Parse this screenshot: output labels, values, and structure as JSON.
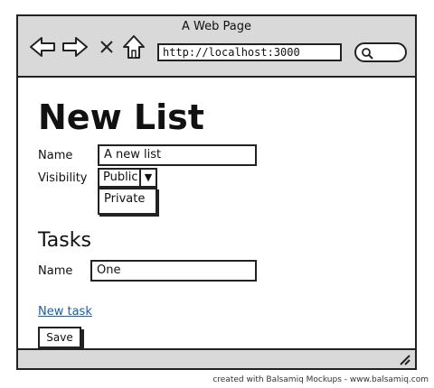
{
  "browser": {
    "title": "A Web Page",
    "url": "http://localhost:3000"
  },
  "page": {
    "heading": "New List",
    "name_label": "Name",
    "name_value": "A new list",
    "visibility_label": "Visibility",
    "visibility_selected": "Public",
    "visibility_option": "Private",
    "tasks_heading": "Tasks",
    "task_name_label": "Name",
    "task_name_value": "One",
    "new_task_link": "New task",
    "save_label": "Save"
  },
  "footer": {
    "watermark": "created with Balsamiq Mockups - www.balsamiq.com"
  }
}
